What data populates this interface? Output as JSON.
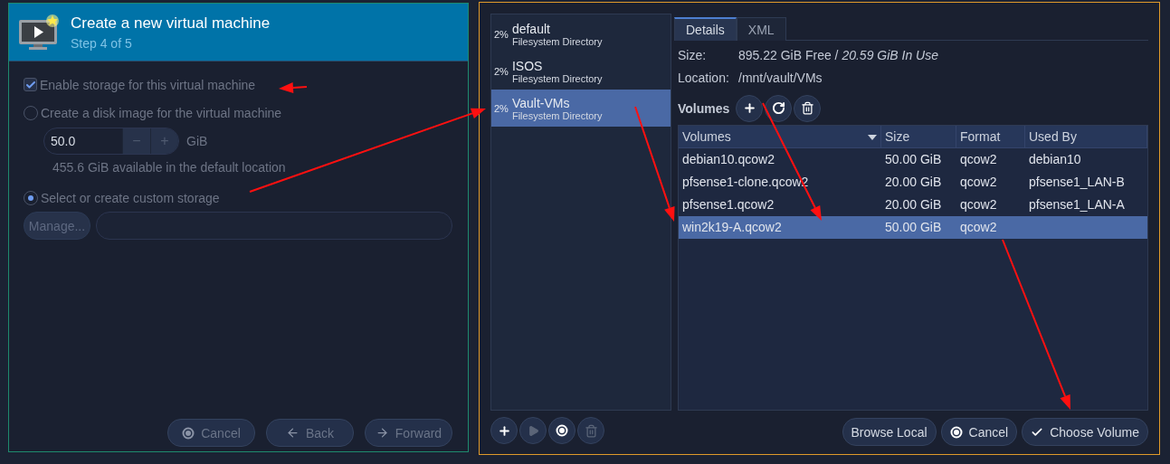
{
  "wizard": {
    "title": "Create a new virtual machine",
    "step": "Step 4 of 5",
    "storage_checkbox": {
      "label": "Enable storage for this virtual machine",
      "checked": true,
      "disabled": true
    },
    "disk_option": {
      "label": "Create a disk image for the virtual machine",
      "selected": false
    },
    "size_field": {
      "value": "50.0",
      "unit": "GiB",
      "minus": "−",
      "plus": "+"
    },
    "available_note": "455.6 GiB available in the default location",
    "custom_option": {
      "label": "Select or create custom storage",
      "selected": true
    },
    "manage_button": {
      "label": "Manage..."
    },
    "buttons": [
      {
        "kind": "cancel",
        "label": "Cancel",
        "disabled": true
      },
      {
        "kind": "back",
        "label": "Back",
        "disabled": true
      },
      {
        "kind": "forward",
        "label": "Forward",
        "disabled": true
      }
    ]
  },
  "storage_browser": {
    "pools": [
      {
        "usage": "2%",
        "name": "default",
        "type": "Filesystem Directory",
        "selected": false
      },
      {
        "usage": "2%",
        "name": "ISOS",
        "type": "Filesystem Directory",
        "selected": false
      },
      {
        "usage": "2%",
        "name": "Vault-VMs",
        "type": "Filesystem Directory",
        "selected": true
      }
    ],
    "pool_toolbar": [
      {
        "kind": "add",
        "disabled": false
      },
      {
        "kind": "start",
        "disabled": true
      },
      {
        "kind": "stop",
        "disabled": false
      },
      {
        "kind": "delete",
        "disabled": true
      }
    ],
    "tabs": [
      {
        "label": "Details",
        "selected": true
      },
      {
        "label": "XML",
        "selected": false
      }
    ],
    "size_label": "Size:",
    "size_value": "895.22 GiB Free / *20.59 GiB In Use*",
    "location_label": "Location:",
    "location_value": "/mnt/vault/VMs",
    "volumes_label": "Volumes",
    "volume_toolbar": [
      {
        "kind": "add"
      },
      {
        "kind": "refresh"
      },
      {
        "kind": "delete"
      }
    ],
    "columns": [
      "Volumes",
      "Size",
      "Format",
      "Used By"
    ],
    "rows": [
      {
        "cells": [
          "debian10.qcow2",
          "50.00 GiB",
          "qcow2",
          "debian10"
        ],
        "selected": false
      },
      {
        "cells": [
          "pfsense1-clone.qcow2",
          "20.00 GiB",
          "qcow2",
          "pfsense1_LAN-B"
        ],
        "selected": false
      },
      {
        "cells": [
          "pfsense1.qcow2",
          "20.00 GiB",
          "qcow2",
          "pfsense1_LAN-A"
        ],
        "selected": false
      },
      {
        "cells": [
          "win2k19-A.qcow2",
          "50.00 GiB",
          "qcow2",
          ""
        ],
        "selected": true
      }
    ],
    "buttons": [
      {
        "kind": "browse",
        "label": "Browse Local"
      },
      {
        "kind": "cancel",
        "label": "Cancel"
      },
      {
        "kind": "choose",
        "label": "Choose Volume"
      }
    ]
  }
}
